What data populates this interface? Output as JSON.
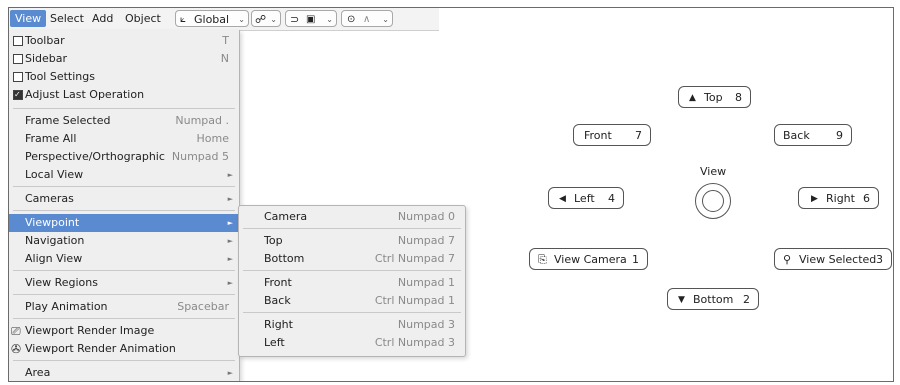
{
  "header": {
    "menus": [
      "View",
      "Select",
      "Add",
      "Object"
    ],
    "orientation": "Global"
  },
  "view_menu": {
    "toolbar": {
      "label": "Toolbar",
      "shortcut": "T",
      "checked": false
    },
    "sidebar": {
      "label": "Sidebar",
      "shortcut": "N",
      "checked": false
    },
    "tool_settings": {
      "label": "Tool Settings",
      "checked": false
    },
    "adjust_last": {
      "label": "Adjust Last Operation",
      "checked": true
    },
    "frame_selected": {
      "label": "Frame Selected",
      "shortcut": "Numpad ."
    },
    "frame_all": {
      "label": "Frame All",
      "shortcut": "Home"
    },
    "persp_ortho": {
      "label": "Perspective/Orthographic",
      "shortcut": "Numpad 5"
    },
    "local_view": {
      "label": "Local View"
    },
    "cameras": {
      "label": "Cameras"
    },
    "viewpoint": {
      "label": "Viewpoint"
    },
    "navigation": {
      "label": "Navigation"
    },
    "align_view": {
      "label": "Align View"
    },
    "view_regions": {
      "label": "View Regions"
    },
    "play_animation": {
      "label": "Play Animation",
      "shortcut": "Spacebar"
    },
    "render_image": {
      "label": "Viewport Render Image"
    },
    "render_animation": {
      "label": "Viewport Render Animation"
    },
    "area": {
      "label": "Area"
    }
  },
  "viewpoint_submenu": {
    "camera": {
      "label": "Camera",
      "shortcut": "Numpad 0"
    },
    "top": {
      "label": "Top",
      "shortcut": "Numpad 7"
    },
    "bottom": {
      "label": "Bottom",
      "shortcut": "Ctrl Numpad 7"
    },
    "front": {
      "label": "Front",
      "shortcut": "Numpad 1"
    },
    "back": {
      "label": "Back",
      "shortcut": "Ctrl Numpad 1"
    },
    "right": {
      "label": "Right",
      "shortcut": "Numpad 3"
    },
    "left": {
      "label": "Left",
      "shortcut": "Ctrl Numpad 3"
    }
  },
  "pie_menu": {
    "title": "View",
    "top": {
      "label": "Top",
      "key": "8"
    },
    "front": {
      "label": "Front",
      "key": "7"
    },
    "back": {
      "label": "Back",
      "key": "9"
    },
    "left": {
      "label": "Left",
      "key": "4"
    },
    "right": {
      "label": "Right",
      "key": "6"
    },
    "view_camera": {
      "label": "View Camera",
      "key": "1"
    },
    "view_selected": {
      "label": "View Selected",
      "key": "3"
    },
    "bottom": {
      "label": "Bottom",
      "key": "2"
    }
  },
  "colors": {
    "highlight": "#5a8ad0",
    "menu_bg": "#efefef"
  }
}
